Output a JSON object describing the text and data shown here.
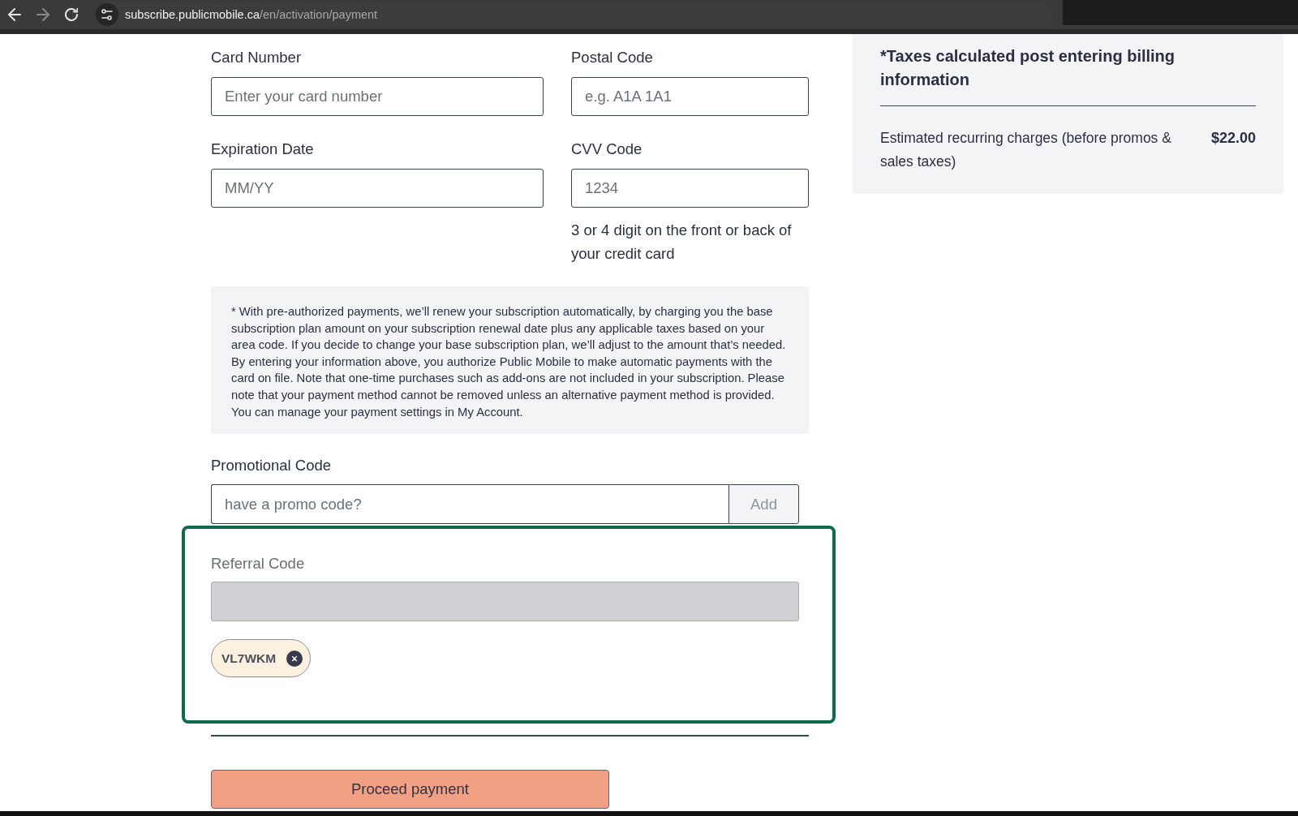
{
  "browser": {
    "nav": [
      {
        "kind": "back",
        "disabled": false
      },
      {
        "kind": "forward",
        "disabled": true
      },
      {
        "kind": "reload",
        "disabled": false
      }
    ],
    "url": {
      "host": "subscribe.publicmobile.ca",
      "path": "/en/activation/payment"
    }
  },
  "form": {
    "fields": [
      {
        "label": "Card Number",
        "placeholder": "Enter your card number"
      },
      {
        "label": "Postal Code",
        "placeholder": "e.g. A1A 1A1"
      },
      {
        "label": "Expiration Date",
        "placeholder": "MM/YY"
      },
      {
        "label": "CVV Code",
        "placeholder": "1234",
        "hint": "3 or 4 digit on the front or back of your credit card"
      }
    ],
    "notice": "* With pre-authorized payments, we’ll renew your subscription automatically, by charging you the base subscription plan amount on your subscription renewal date plus any applicable taxes based on your area code. If you decide to change your base subscription plan, we’ll adjust to the amount that’s needed. By entering your information above, you authorize Public Mobile to make automatic payments with the card on file. Note that one-time purchases such as add-ons are not included in your subscription. Please note that your payment method cannot be removed unless an alternative payment method is provided. You can manage your payment settings in My Account.",
    "promo": {
      "label": "Promotional Code",
      "placeholder": "have a promo code?",
      "button": "Add",
      "button_disabled": true
    },
    "referral": {
      "label": "Referral Code",
      "disabled": true,
      "highlighted": true,
      "codes": [
        "VL7WKM"
      ]
    },
    "submit": "Proceed payment"
  },
  "summary": {
    "title": "*Taxes calculated post entering billing information",
    "charges": [
      {
        "label": "Estimated recurring charges (before promos & sales taxes)",
        "amount": "$22.00"
      }
    ]
  }
}
